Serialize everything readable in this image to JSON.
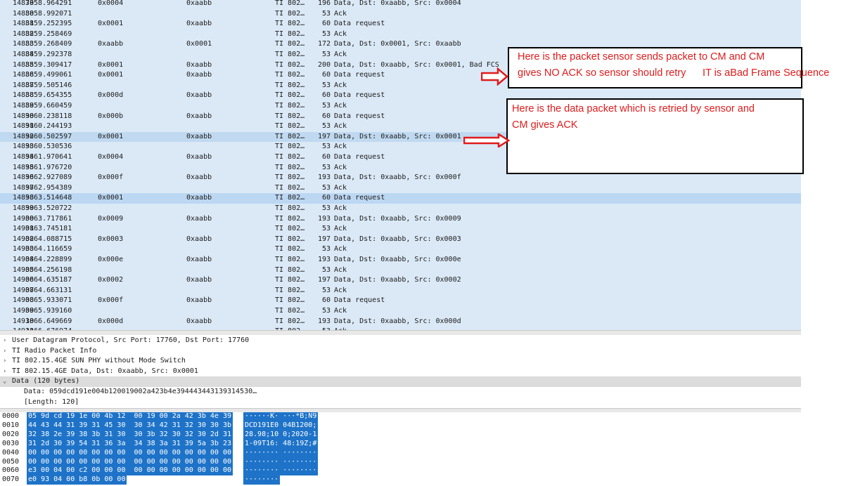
{
  "packets": [
    {
      "no": "14879",
      "time": "3858.964291",
      "src": "0x0004",
      "dst": "0xaabb",
      "proto": "TI 802…",
      "len": "196",
      "info": "Data, Dst: 0xaabb, Src: 0x0004"
    },
    {
      "no": "14880",
      "time": "3858.992071",
      "src": "",
      "dst": "",
      "proto": "TI 802…",
      "len": "53",
      "info": "Ack"
    },
    {
      "no": "14881",
      "time": "3859.252395",
      "src": "0x0001",
      "dst": "0xaabb",
      "proto": "TI 802…",
      "len": "60",
      "info": "Data request"
    },
    {
      "no": "14882",
      "time": "3859.258469",
      "src": "",
      "dst": "",
      "proto": "TI 802…",
      "len": "53",
      "info": "Ack"
    },
    {
      "no": "14883",
      "time": "3859.268409",
      "src": "0xaabb",
      "dst": "0x0001",
      "proto": "TI 802…",
      "len": "172",
      "info": "Data, Dst: 0x0001, Src: 0xaabb"
    },
    {
      "no": "14884",
      "time": "3859.292378",
      "src": "",
      "dst": "",
      "proto": "TI 802…",
      "len": "53",
      "info": "Ack"
    },
    {
      "no": "14885",
      "time": "3859.309417",
      "src": "0x0001",
      "dst": "0xaabb",
      "proto": "TI 802…",
      "len": "200",
      "info": "Data, Dst: 0xaabb, Src: 0x0001, Bad FCS"
    },
    {
      "no": "14886",
      "time": "3859.499061",
      "src": "0x0001",
      "dst": "0xaabb",
      "proto": "TI 802…",
      "len": "60",
      "info": "Data request"
    },
    {
      "no": "14887",
      "time": "3859.505146",
      "src": "",
      "dst": "",
      "proto": "TI 802…",
      "len": "53",
      "info": "Ack"
    },
    {
      "no": "14888",
      "time": "3859.654355",
      "src": "0x000d",
      "dst": "0xaabb",
      "proto": "TI 802…",
      "len": "60",
      "info": "Data request"
    },
    {
      "no": "14889",
      "time": "3859.660459",
      "src": "",
      "dst": "",
      "proto": "TI 802…",
      "len": "53",
      "info": "Ack"
    },
    {
      "no": "14890",
      "time": "3860.238118",
      "src": "0x000b",
      "dst": "0xaabb",
      "proto": "TI 802…",
      "len": "60",
      "info": "Data request"
    },
    {
      "no": "14891",
      "time": "3860.244193",
      "src": "",
      "dst": "",
      "proto": "TI 802…",
      "len": "53",
      "info": "Ack"
    },
    {
      "no": "14892",
      "time": "3860.502597",
      "src": "0x0001",
      "dst": "0xaabb",
      "proto": "TI 802…",
      "len": "197",
      "info": "Data, Dst: 0xaabb, Src: 0x0001"
    },
    {
      "no": "14893",
      "time": "3860.530536",
      "src": "",
      "dst": "",
      "proto": "TI 802…",
      "len": "53",
      "info": "Ack"
    },
    {
      "no": "14894",
      "time": "3861.970641",
      "src": "0x0004",
      "dst": "0xaabb",
      "proto": "TI 802…",
      "len": "60",
      "info": "Data request"
    },
    {
      "no": "14895",
      "time": "3861.976720",
      "src": "",
      "dst": "",
      "proto": "TI 802…",
      "len": "53",
      "info": "Ack"
    },
    {
      "no": "14896",
      "time": "3862.927089",
      "src": "0x000f",
      "dst": "0xaabb",
      "proto": "TI 802…",
      "len": "193",
      "info": "Data, Dst: 0xaabb, Src: 0x000f"
    },
    {
      "no": "14897",
      "time": "3862.954389",
      "src": "",
      "dst": "",
      "proto": "TI 802…",
      "len": "53",
      "info": "Ack"
    },
    {
      "no": "14898",
      "time": "3863.514648",
      "src": "0x0001",
      "dst": "0xaabb",
      "proto": "TI 802…",
      "len": "60",
      "info": "Data request"
    },
    {
      "no": "14899",
      "time": "3863.520722",
      "src": "",
      "dst": "",
      "proto": "TI 802…",
      "len": "53",
      "info": "Ack"
    },
    {
      "no": "14900",
      "time": "3863.717861",
      "src": "0x0009",
      "dst": "0xaabb",
      "proto": "TI 802…",
      "len": "193",
      "info": "Data, Dst: 0xaabb, Src: 0x0009"
    },
    {
      "no": "14901",
      "time": "3863.745181",
      "src": "",
      "dst": "",
      "proto": "TI 802…",
      "len": "53",
      "info": "Ack"
    },
    {
      "no": "14902",
      "time": "3864.088715",
      "src": "0x0003",
      "dst": "0xaabb",
      "proto": "TI 802…",
      "len": "197",
      "info": "Data, Dst: 0xaabb, Src: 0x0003"
    },
    {
      "no": "14903",
      "time": "3864.116659",
      "src": "",
      "dst": "",
      "proto": "TI 802…",
      "len": "53",
      "info": "Ack"
    },
    {
      "no": "14904",
      "time": "3864.228899",
      "src": "0x000e",
      "dst": "0xaabb",
      "proto": "TI 802…",
      "len": "193",
      "info": "Data, Dst: 0xaabb, Src: 0x000e"
    },
    {
      "no": "14905",
      "time": "3864.256198",
      "src": "",
      "dst": "",
      "proto": "TI 802…",
      "len": "53",
      "info": "Ack"
    },
    {
      "no": "14906",
      "time": "3864.635187",
      "src": "0x0002",
      "dst": "0xaabb",
      "proto": "TI 802…",
      "len": "197",
      "info": "Data, Dst: 0xaabb, Src: 0x0002"
    },
    {
      "no": "14907",
      "time": "3864.663131",
      "src": "",
      "dst": "",
      "proto": "TI 802…",
      "len": "53",
      "info": "Ack"
    },
    {
      "no": "14908",
      "time": "3865.933071",
      "src": "0x000f",
      "dst": "0xaabb",
      "proto": "TI 802…",
      "len": "60",
      "info": "Data request"
    },
    {
      "no": "14909",
      "time": "3865.939160",
      "src": "",
      "dst": "",
      "proto": "TI 802…",
      "len": "53",
      "info": "Ack"
    },
    {
      "no": "14910",
      "time": "3866.649669",
      "src": "0x000d",
      "dst": "0xaabb",
      "proto": "TI 802…",
      "len": "193",
      "info": "Data, Dst: 0xaabb, Src: 0x000d"
    },
    {
      "no": "14911",
      "time": "3866.676974",
      "src": "",
      "dst": "",
      "proto": "TI 802…",
      "len": "53",
      "info": "Ack"
    }
  ],
  "details": [
    {
      "arrow": ">",
      "text": "User Datagram Protocol, Src Port: 17760, Dst Port: 17760"
    },
    {
      "arrow": ">",
      "text": "TI Radio Packet Info"
    },
    {
      "arrow": ">",
      "text": "TI 802.15.4GE SUN PHY without Mode Switch"
    },
    {
      "arrow": ">",
      "text": "TI 802.15.4GE Data, Dst: 0xaabb, Src: 0x0001"
    },
    {
      "arrow": "v",
      "text": "Data (120 bytes)"
    },
    {
      "arrow": "",
      "text": "Data: 059dcd191e004b120019002a423b4e394443443139314530…"
    },
    {
      "arrow": "",
      "text": "[Length: 120]"
    }
  ],
  "bytes": [
    {
      "offset": "0000",
      "hex": "05 9d cd 19 1e 00 4b 12  00 19 00 2a 42 3b 4e 39",
      "ascii": "······K· ···*B;N9"
    },
    {
      "offset": "0010",
      "hex": "44 43 44 31 39 31 45 30  30 34 42 31 32 30 30 3b",
      "ascii": "DCD191E0 04B1200;"
    },
    {
      "offset": "0020",
      "hex": "32 38 2e 39 38 3b 31 30  30 3b 32 30 32 30 2d 31",
      "ascii": "28.98;10 0;2020-1"
    },
    {
      "offset": "0030",
      "hex": "31 2d 30 39 54 31 36 3a  34 38 3a 31 39 5a 3b 23",
      "ascii": "1-09T16: 48:19Z;#"
    },
    {
      "offset": "0040",
      "hex": "00 00 00 00 00 00 00 00  00 00 00 00 00 00 00 00",
      "ascii": "········ ········"
    },
    {
      "offset": "0050",
      "hex": "00 00 00 00 00 00 00 00  00 00 00 00 00 00 00 00",
      "ascii": "········ ········"
    },
    {
      "offset": "0060",
      "hex": "e3 00 04 00 c2 00 00 00  00 00 00 00 00 00 00 00",
      "ascii": "········ ········"
    },
    {
      "offset": "0070",
      "hex": "e0 93 04 00 b8 0b 00 00",
      "ascii": "········"
    }
  ],
  "annotations": {
    "box1_line1": "Here is the packet sensor sends packet to CM and CM",
    "box1_line2": "gives NO ACK so sensor should retry",
    "overlay": "IT is aBad Frame Sequence",
    "box2_line1": "Here is the data packet which is retried by sensor and",
    "box2_line2": "CM gives ACK"
  },
  "colors": {
    "list_bg": "#dbe9f7",
    "selected": "#1e73c8",
    "annotation": "#e01b1b"
  }
}
